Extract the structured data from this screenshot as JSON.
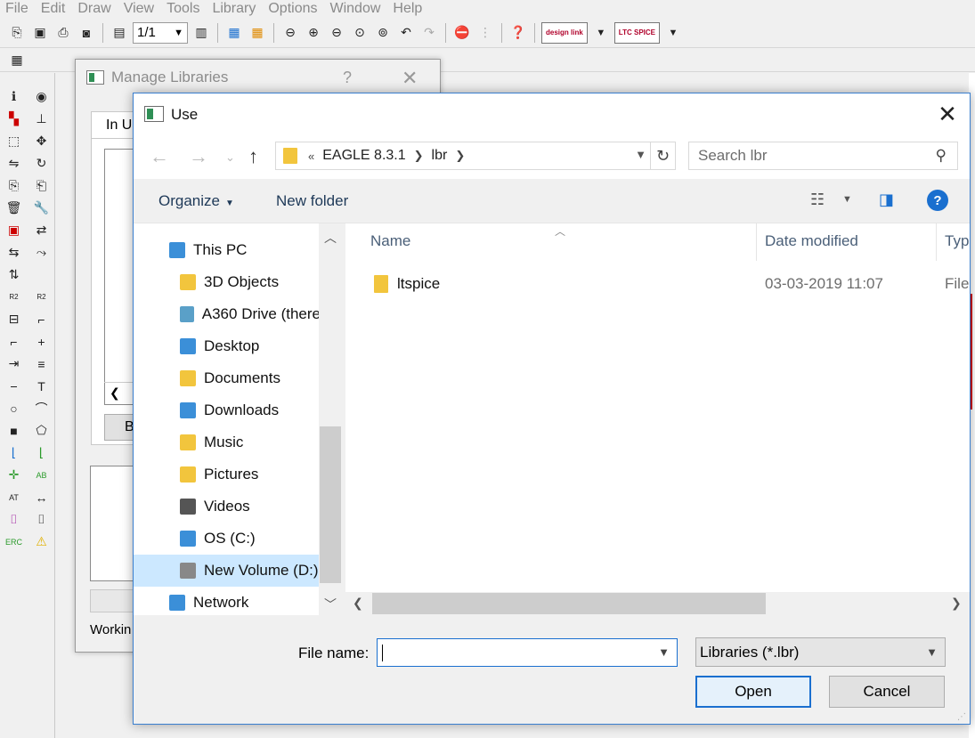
{
  "menubar": {
    "items": [
      "File",
      "Edit",
      "Draw",
      "View",
      "Tools",
      "Library",
      "Options",
      "Window",
      "Help"
    ]
  },
  "toolbar": {
    "sheet_select": "1/1",
    "logos": [
      "design link",
      "LTC SPICE"
    ]
  },
  "manage_dialog": {
    "title": "Manage Libraries",
    "help": "?",
    "close": "✕",
    "tab_label": "In U",
    "button_label": "B",
    "footer_label": "Workin"
  },
  "use_dialog": {
    "title": "Use",
    "close": "✕",
    "address": {
      "overflow": "«",
      "crumbs": [
        "EAGLE 8.3.1",
        "lbr"
      ]
    },
    "search_placeholder": "Search lbr",
    "commands": {
      "organize": "Organize",
      "new_folder": "New folder"
    },
    "nav_items": [
      {
        "label": "This PC",
        "icon": "computer-icon",
        "level": 1
      },
      {
        "label": "3D Objects",
        "icon": "3d-objects-folder-icon",
        "level": 2
      },
      {
        "label": "A360 Drive (there",
        "icon": "a360-drive-icon",
        "level": 2
      },
      {
        "label": "Desktop",
        "icon": "desktop-folder-icon",
        "level": 2
      },
      {
        "label": "Documents",
        "icon": "documents-folder-icon",
        "level": 2
      },
      {
        "label": "Downloads",
        "icon": "downloads-folder-icon",
        "level": 2
      },
      {
        "label": "Music",
        "icon": "music-folder-icon",
        "level": 2
      },
      {
        "label": "Pictures",
        "icon": "pictures-folder-icon",
        "level": 2
      },
      {
        "label": "Videos",
        "icon": "videos-folder-icon",
        "level": 2
      },
      {
        "label": "OS (C:)",
        "icon": "os-drive-icon",
        "level": 2
      },
      {
        "label": "New Volume (D:)",
        "icon": "drive-icon",
        "level": 2,
        "selected": true
      },
      {
        "label": "Network",
        "icon": "network-icon",
        "level": 1
      }
    ],
    "columns": {
      "name": "Name",
      "date": "Date modified",
      "type": "Typ"
    },
    "files": [
      {
        "name": "ltspice",
        "date": "03-03-2019 11:07",
        "type": "File"
      }
    ],
    "file_name_label": "File name:",
    "file_name_value": "",
    "filter": "Libraries (*.lbr)",
    "open_label": "Open",
    "cancel_label": "Cancel"
  },
  "colors": {
    "accent": "#1a6fcf",
    "folder": "#f2c53d",
    "selection": "#cce8ff"
  }
}
